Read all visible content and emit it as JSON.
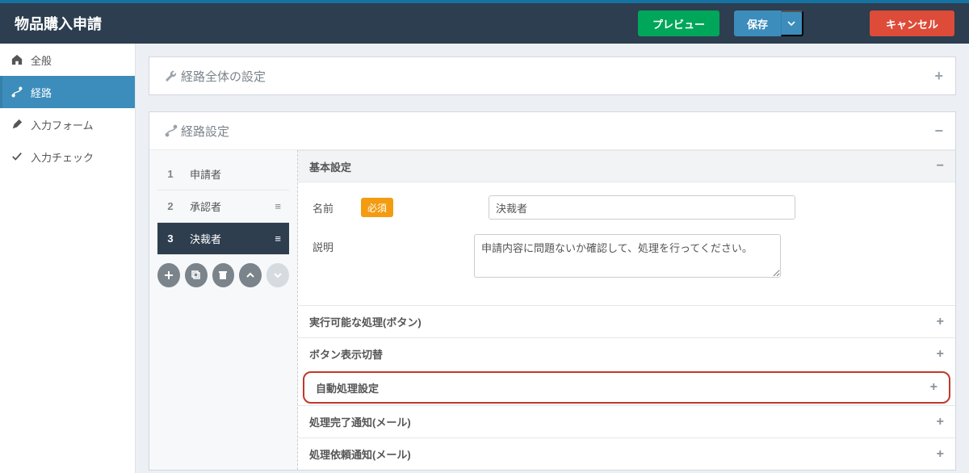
{
  "header": {
    "title": "物品購入申請",
    "preview": "プレビュー",
    "save": "保存",
    "cancel": "キャンセル"
  },
  "sidebar": {
    "items": [
      {
        "label": "全般"
      },
      {
        "label": "経路"
      },
      {
        "label": "入力フォーム"
      },
      {
        "label": "入力チェック"
      }
    ]
  },
  "panels": {
    "overall": {
      "title": "経路全体の設定"
    },
    "route": {
      "title": "経路設定"
    }
  },
  "steps": [
    {
      "num": "1",
      "label": "申請者"
    },
    {
      "num": "2",
      "label": "承認者"
    },
    {
      "num": "3",
      "label": "決裁者"
    }
  ],
  "detail": {
    "basic": {
      "title": "基本設定",
      "name_label": "名前",
      "required_badge": "必須",
      "name_value": "決裁者",
      "desc_label": "説明",
      "desc_value": "申請内容に問題ないか確認して、処理を行ってください。"
    },
    "sections": [
      {
        "key": "exec",
        "title": "実行可能な処理(ボタン)"
      },
      {
        "key": "toggle",
        "title": "ボタン表示切替"
      },
      {
        "key": "auto",
        "title": "自動処理設定",
        "highlight": true
      },
      {
        "key": "done_mail",
        "title": "処理完了通知(メール)"
      },
      {
        "key": "req_mail",
        "title": "処理依頼通知(メール)"
      }
    ]
  }
}
